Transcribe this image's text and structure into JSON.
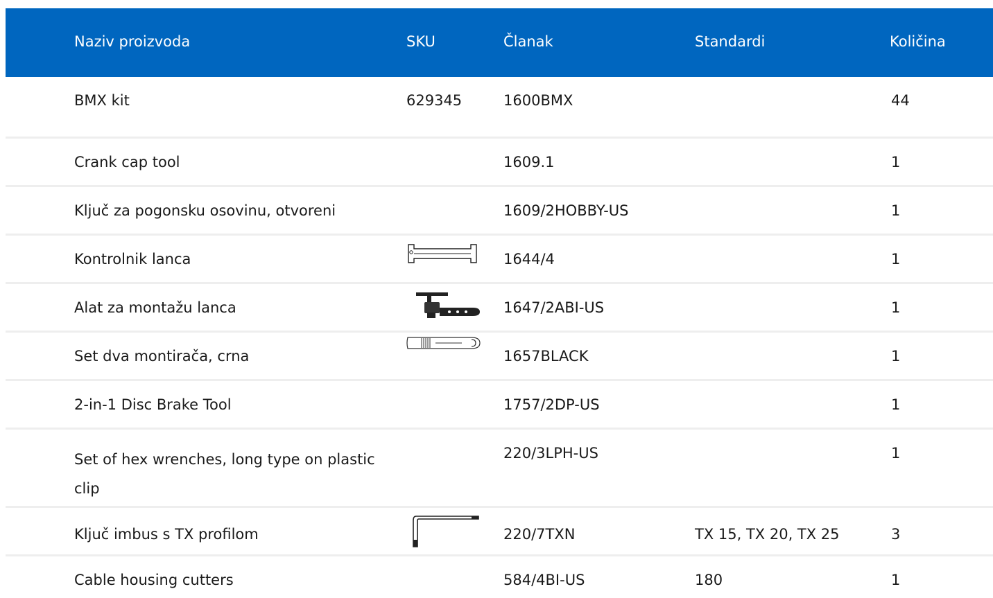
{
  "table": {
    "headers": {
      "name": "Naziv proizvoda",
      "sku": "SKU",
      "article": "Članak",
      "standards": "Standardi",
      "quantity": "Količina"
    },
    "rows": [
      {
        "name": "BMX kit",
        "sku": "629345",
        "article": "1600BMX",
        "standards": "",
        "quantity": "44"
      },
      {
        "name": "Crank cap tool",
        "sku": "",
        "article": "1609.1",
        "standards": "",
        "quantity": "1"
      },
      {
        "name": "Ključ za pogonsku osovinu, otvoreni",
        "sku": "",
        "article": "1609/2HOBBY-US",
        "standards": "",
        "quantity": "1"
      },
      {
        "name": "Kontrolnik lanca",
        "sku": "",
        "image": "chain-checker-icon",
        "article": "1644/4",
        "standards": "",
        "quantity": "1"
      },
      {
        "name": "Alat za montažu lanca",
        "sku": "",
        "image": "chain-tool-icon",
        "article": "1647/2ABI-US",
        "standards": "",
        "quantity": "1"
      },
      {
        "name": "Set dva montirača, crna",
        "sku": "",
        "image": "tire-lever-icon",
        "article": "1657BLACK",
        "standards": "",
        "quantity": "1"
      },
      {
        "name": "2-in-1 Disc Brake Tool",
        "sku": "",
        "article": "1757/2DP-US",
        "standards": "",
        "quantity": "1"
      },
      {
        "name": "Set of hex wrenches, long type on plastic clip",
        "sku": "",
        "article": "220/3LPH-US",
        "standards": "",
        "quantity": "1"
      },
      {
        "name": "Ključ imbus s TX profilom",
        "sku": "",
        "image": "torx-key-icon",
        "article": "220/7TXN",
        "standards": "TX 15, TX 20, TX 25",
        "quantity": "3"
      },
      {
        "name": "Cable housing cutters",
        "sku": "",
        "article": "584/4BI-US",
        "standards": "180",
        "quantity": "1"
      }
    ]
  },
  "colors": {
    "header_bg": "#0066bf",
    "header_text": "#ffffff",
    "divider": "#eeeeee"
  }
}
